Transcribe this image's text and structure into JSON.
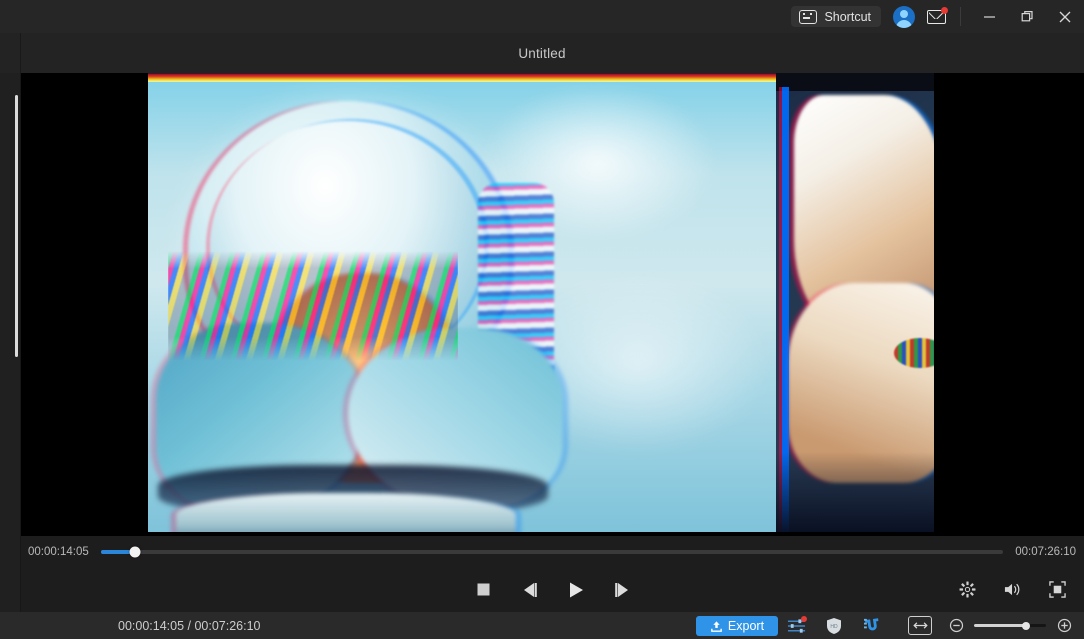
{
  "window": {
    "shortcut_label": "Shortcut",
    "shortcut_icon": "keyboard-icon",
    "account_icon": "user-avatar-icon",
    "messages_icon": "mail-icon",
    "messages_badge": "1",
    "minimize_icon": "minimize-icon",
    "restore_icon": "restore-icon",
    "close_icon": "close-icon"
  },
  "tab": {
    "title": "Untitled"
  },
  "preview": {
    "video_description": "glitch chromatic-aberration still of a person wearing an astronaut helmet covering their face with both hands against a pale blue sky",
    "accent_color": "#2b86d9"
  },
  "seek": {
    "current_time": "00:00:14:05",
    "total_time": "00:07:26:10",
    "progress_percent": 3.8
  },
  "transport": {
    "stop_label": "Stop",
    "prev_frame_label": "Previous Frame",
    "play_label": "Play",
    "next_frame_label": "Next Frame",
    "settings_icon": "gear-icon",
    "volume_icon": "speaker-icon",
    "fullscreen_icon": "fullscreen-icon"
  },
  "bottom": {
    "timecode": "00:00:14:05 / 00:07:26:10",
    "export_label": "Export",
    "export_icon": "upload-icon",
    "export_color": "#2f93e8",
    "tool_icons": [
      {
        "name": "mixer-icon",
        "badge": true
      },
      {
        "name": "shield-icon",
        "badge": false
      },
      {
        "name": "magnet-icon",
        "badge": false
      }
    ],
    "fit_icon": "fit-to-width-icon",
    "zoom_out_icon": "zoom-out-icon",
    "zoom_in_icon": "zoom-in-icon",
    "zoom_percent": 72
  }
}
